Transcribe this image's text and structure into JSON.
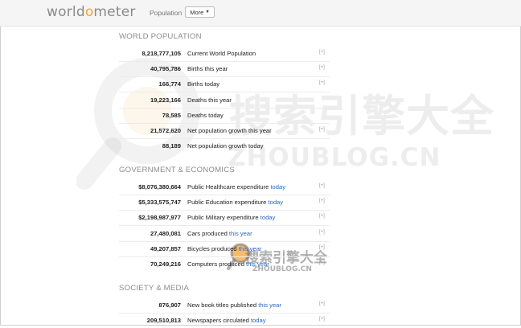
{
  "header": {
    "logo_prefix": "worldo",
    "logo_mid": "o",
    "logo_suffix": "meter",
    "nav_population": "Population",
    "more_label": "More"
  },
  "sections": [
    {
      "title": "WORLD POPULATION",
      "rows": [
        {
          "value": "8,218,777,105",
          "label": "Current World Population",
          "link": "",
          "show_expand": true
        },
        {
          "value": "40,795,786",
          "label": "Births this year",
          "link": "",
          "show_expand": true
        },
        {
          "value": "166,774",
          "label": "Births today",
          "link": "",
          "show_expand": true
        },
        {
          "value": "19,223,166",
          "label": "Deaths this year",
          "link": "",
          "show_expand": false
        },
        {
          "value": "78,585",
          "label": "Deaths today",
          "link": "",
          "show_expand": false
        },
        {
          "value": "21,572,620",
          "label": "Net population growth this year",
          "link": "",
          "show_expand": true
        },
        {
          "value": "88,189",
          "label": "Net population growth today",
          "link": "",
          "show_expand": false
        }
      ]
    },
    {
      "title": "GOVERNMENT & ECONOMICS",
      "rows": [
        {
          "value": "$8,076,380,664",
          "label": "Public Healthcare expenditure",
          "link": "today",
          "show_expand": true
        },
        {
          "value": "$5,333,575,747",
          "label": "Public Education expenditure",
          "link": "today",
          "show_expand": true
        },
        {
          "value": "$2,198,987,977",
          "label": "Public Military expenditure",
          "link": "today",
          "show_expand": true
        },
        {
          "value": "27,480,081",
          "label": "Cars produced",
          "link": "this year",
          "show_expand": true
        },
        {
          "value": "49,207,857",
          "label": "Bicycles produced",
          "link": "this year",
          "show_expand": true
        },
        {
          "value": "70,249,216",
          "label": "Computers produced",
          "link": "this year",
          "show_expand": true
        }
      ]
    },
    {
      "title": "SOCIETY & MEDIA",
      "rows": [
        {
          "value": "876,907",
          "label": "New book titles published",
          "link": "this year",
          "show_expand": true
        },
        {
          "value": "209,510,813",
          "label": "Newspapers circulated",
          "link": "today",
          "show_expand": true
        }
      ]
    }
  ],
  "expand_label": "[+]",
  "watermark": {
    "main": "搜索引擎大全",
    "sub": "ZHOUBLOG.CN"
  },
  "colors": {
    "link": "#2a66c4",
    "logo_accent": "#f0a53a",
    "section_title": "#8d8d8d"
  }
}
